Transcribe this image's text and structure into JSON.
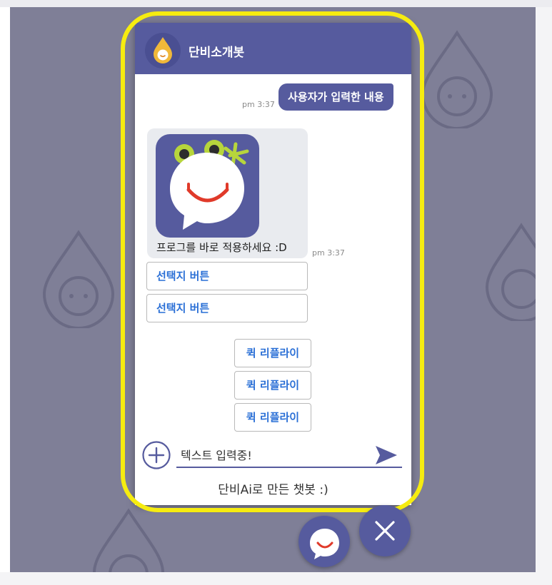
{
  "chat": {
    "bot_name": "단비소개봇",
    "user_message": "사용자가 입력한 내용",
    "user_message_time": "pm 3:37",
    "bot_message_text": "프로그를 바로 적용하세요 :D",
    "bot_message_time": "pm 3:37",
    "choice_buttons": [
      "선택지 버튼",
      "선택지 버튼"
    ],
    "quick_replies": [
      "퀵 리플라이",
      "퀵 리플라이",
      "퀵 리플라이"
    ],
    "input_placeholder": "텍스트 입력중!",
    "footer": "단비Ai로 만든 챗봇 :)"
  },
  "colors": {
    "brand": "#565b9e",
    "backdrop": "#7f7f97",
    "highlight": "#f6ec10",
    "link": "#2a6fd6",
    "smile": "#e03a2a",
    "frog_green": "#b7d53c"
  },
  "icons": {
    "bot_logo": "drop-logo-icon",
    "card_image": "frog-chat-app-icon",
    "attach": "plus-circle-icon",
    "send": "send-arrow-icon",
    "launcher": "chat-smile-icon",
    "close": "close-icon"
  }
}
